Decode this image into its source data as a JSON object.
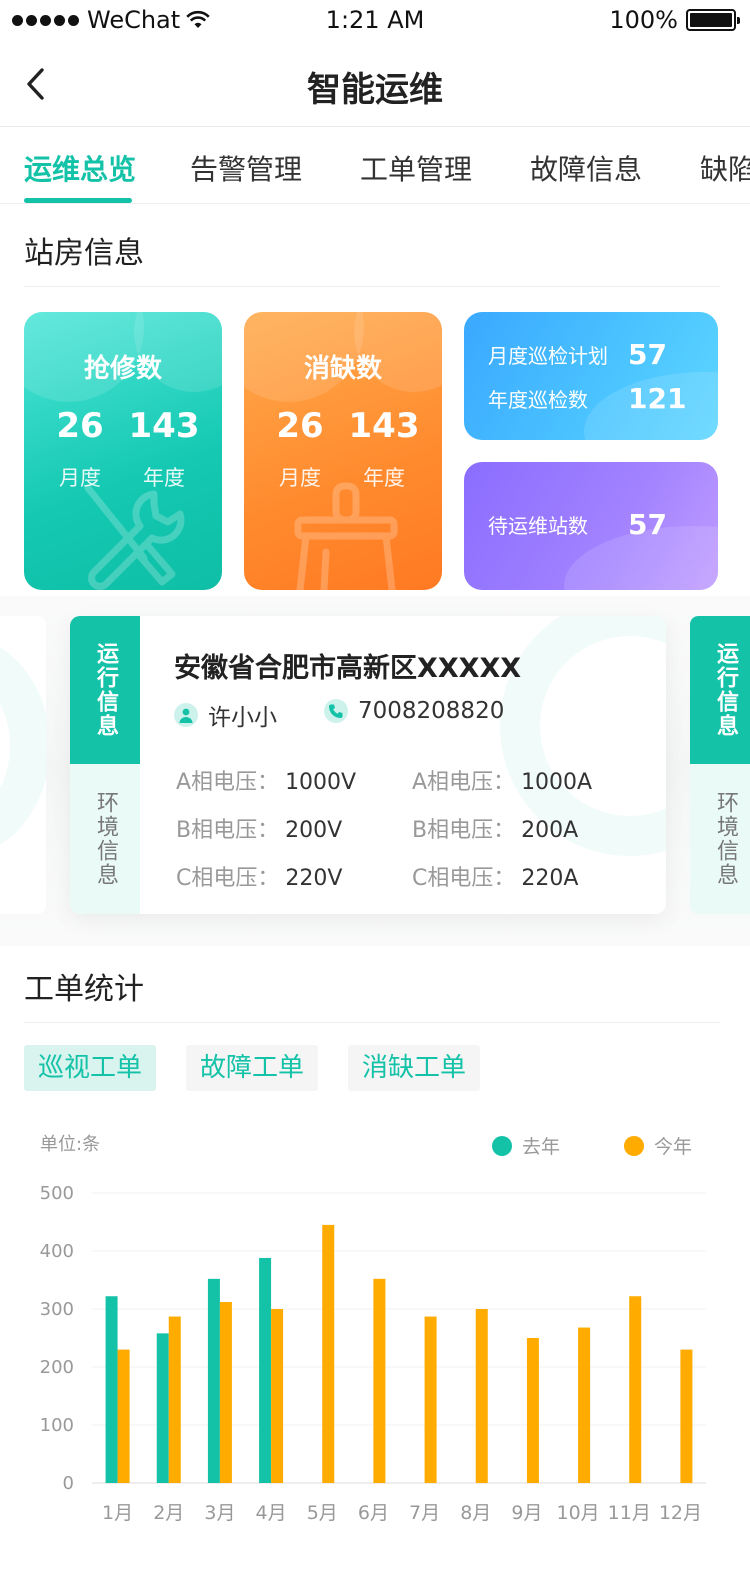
{
  "status_bar": {
    "carrier": "WeChat",
    "time": "1:21 AM",
    "battery": "100%",
    "battery_level": 1.0
  },
  "nav": {
    "title": "智能运维"
  },
  "tabs": [
    {
      "label": "运维总览",
      "active": true
    },
    {
      "label": "告警管理",
      "active": false
    },
    {
      "label": "工单管理",
      "active": false
    },
    {
      "label": "故障信息",
      "active": false
    },
    {
      "label": "缺陷",
      "active": false
    }
  ],
  "station_section": {
    "title": "站房信息"
  },
  "cards": {
    "repair": {
      "title": "抢修数",
      "month_value": "26",
      "year_value": "143",
      "month_label": "月度",
      "year_label": "年度",
      "icon": "wrench-screwdriver-icon",
      "color": "#14c8b2"
    },
    "defect": {
      "title": "消缺数",
      "month_value": "26",
      "year_value": "143",
      "month_label": "月度",
      "year_label": "年度",
      "icon": "brush-icon",
      "color": "#ff8a2e"
    },
    "inspection": {
      "month_plan_label": "月度巡检计划",
      "month_plan_value": "57",
      "year_label": "年度巡检数",
      "year_value": "121",
      "color": "#3aa8ff"
    },
    "pending": {
      "label": "待运维站数",
      "value": "57",
      "color": "#8a6dff"
    }
  },
  "info_card": {
    "tab_active": "运行信息",
    "tab_inactive": "环境信息",
    "address": "安徽省合肥市高新区XXXXX",
    "person": "许小小",
    "phone": "7008208820",
    "metrics": [
      {
        "label": "A相电压：",
        "value": "1000V"
      },
      {
        "label": "A相电压：",
        "value": "1000A"
      },
      {
        "label": "B相电压：",
        "value": "200V"
      },
      {
        "label": "B相电压：",
        "value": "200A"
      },
      {
        "label": "C相电压：",
        "value": "220V"
      },
      {
        "label": "C相电压：",
        "value": "220A"
      }
    ]
  },
  "order_section": {
    "title": "工单统计",
    "filters": [
      {
        "label": "巡视工单",
        "active": true
      },
      {
        "label": "故障工单",
        "active": false
      },
      {
        "label": "消缺工单",
        "active": false
      }
    ]
  },
  "chart_data": {
    "type": "bar",
    "unit_label": "单位:条",
    "categories": [
      "1月",
      "2月",
      "3月",
      "4月",
      "5月",
      "6月",
      "7月",
      "8月",
      "9月",
      "10月",
      "11月",
      "12月"
    ],
    "series": [
      {
        "name": "去年",
        "color": "#14c2a8",
        "values": [
          322,
          258,
          352,
          388,
          null,
          null,
          null,
          null,
          null,
          null,
          null,
          null
        ]
      },
      {
        "name": "今年",
        "color": "#ffab00",
        "values": [
          230,
          287,
          312,
          300,
          445,
          352,
          287,
          300,
          250,
          268,
          322,
          230
        ]
      }
    ],
    "yticks": [
      0,
      100,
      200,
      300,
      400,
      500
    ],
    "ylim": [
      0,
      500
    ],
    "grid": true,
    "legend": "top-right"
  }
}
